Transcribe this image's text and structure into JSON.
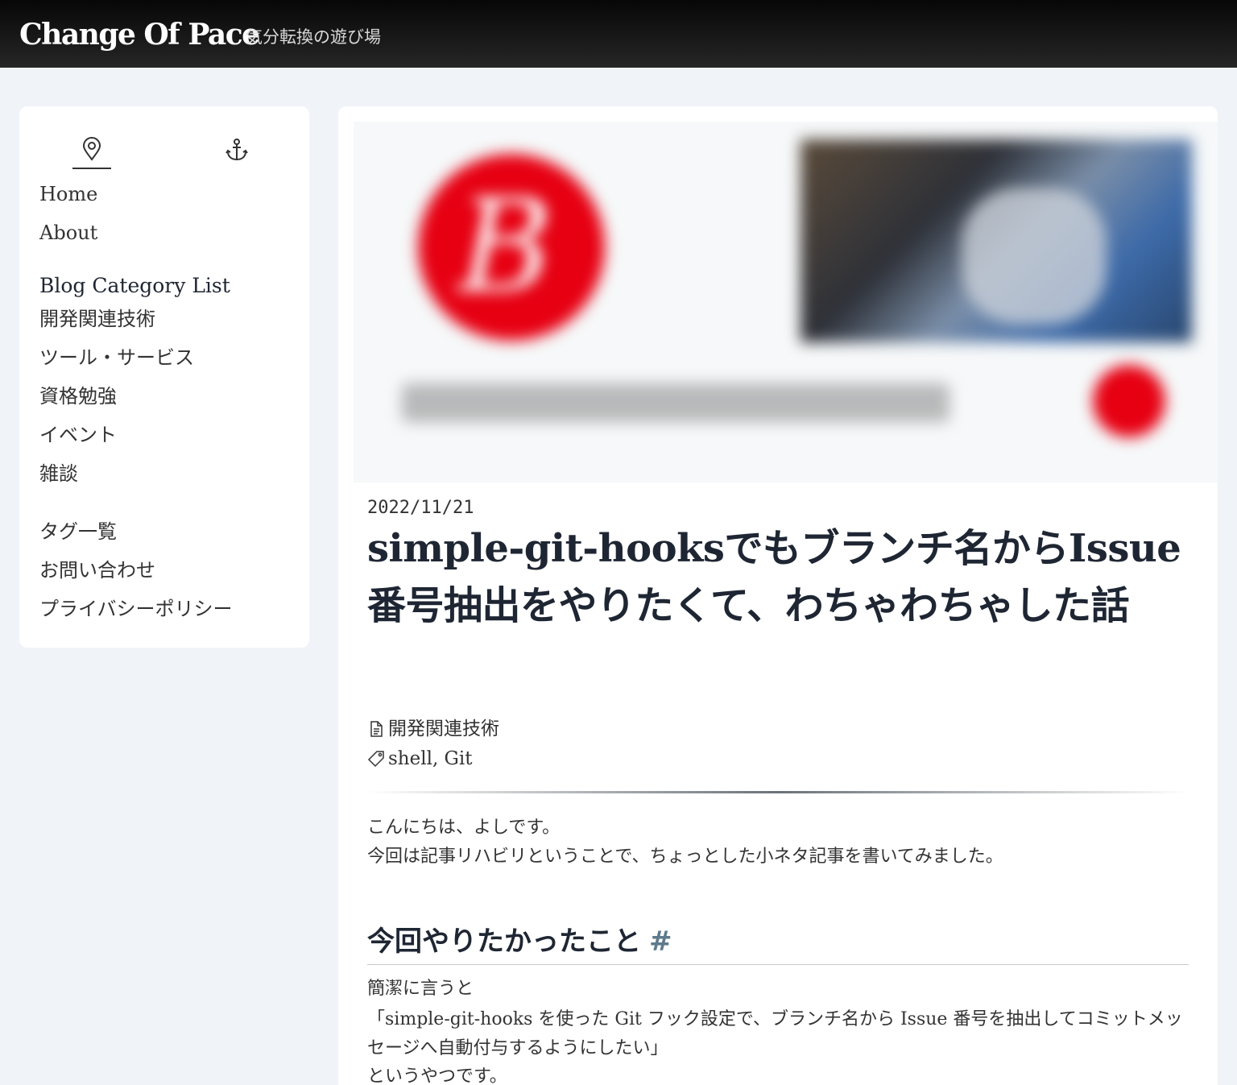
{
  "header": {
    "site_title": "Change Of Pace",
    "subtitle": "気分転換の遊び場"
  },
  "sidebar": {
    "tabs": [
      {
        "icon": "location-pin-icon"
      },
      {
        "icon": "anchor-icon"
      }
    ],
    "nav": [
      "Home",
      "About"
    ],
    "category_heading": "Blog Category List",
    "categories": [
      "開発関連技術",
      "ツール・サービス",
      "資格勉強",
      "イベント",
      "雑談"
    ],
    "links": [
      "タグ一覧",
      "お問い合わせ",
      "プライバシーポリシー"
    ]
  },
  "post": {
    "date": "2022/11/21",
    "title": "simple-git-hooksでもブランチ名からIssue番号抽出をやりたくて、わちゃわちゃした話",
    "category": "開発関連技術",
    "tags": "shell, Git",
    "intro_line1": "こんにちは、よしです。",
    "intro_line2": "今回は記事リハビリということで、ちょっとした小ネタ記事を書いてみました。",
    "section_heading": "今回やりたかったこと",
    "section_anchor": "#",
    "body_line1": "簡潔に言うと",
    "body_line2": "「simple-git-hooks を使った Git フック設定で、ブランチ名から Issue 番号を抽出してコミットメッセージへ自動付与するようにしたい」",
    "body_line3": "というやつです。"
  },
  "colors": {
    "header_bg": "#111111",
    "page_bg": "#f0f3f8",
    "accent_red": "#e60012",
    "anchor": "#5e7a8c"
  }
}
